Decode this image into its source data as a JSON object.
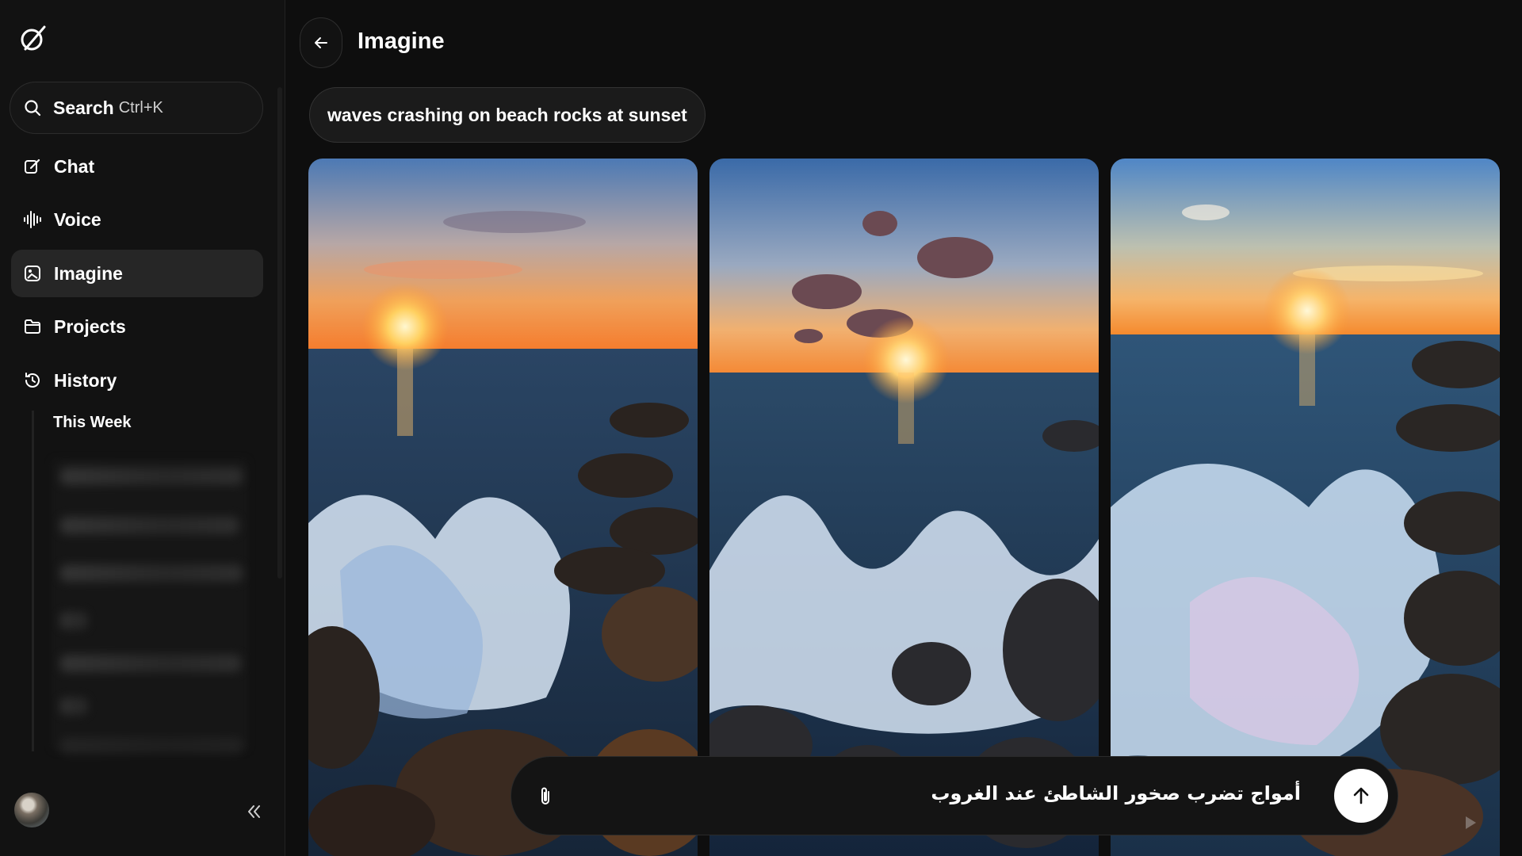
{
  "sidebar": {
    "logo_icon": "grok-logo-icon",
    "search": {
      "label": "Search",
      "shortcut": "Ctrl+K",
      "icon": "search-icon"
    },
    "items": [
      {
        "label": "Chat",
        "icon": "edit-icon"
      },
      {
        "label": "Voice",
        "icon": "voice-waveform-icon"
      },
      {
        "label": "Imagine",
        "icon": "image-sparkle-icon",
        "active": true
      },
      {
        "label": "Projects",
        "icon": "folder-icon"
      },
      {
        "label": "History",
        "icon": "history-icon"
      }
    ],
    "history_group": "This Week",
    "collapse_icon": "double-chevron-left-icon",
    "avatar_icon": "user-avatar"
  },
  "header": {
    "back_icon": "arrow-left-icon",
    "title": "Imagine"
  },
  "prompt": {
    "text": "waves crashing on beach rocks at sunset"
  },
  "composer": {
    "attach_icon": "paperclip-icon",
    "value": "أمواج تضرب صخور الشاطئ عند الغروب",
    "send_icon": "arrow-up-icon"
  },
  "colors": {
    "background": "#0e0e0e",
    "sidebar": "#121212",
    "active_item": "#262626",
    "text": "#ffffff",
    "send_button": "#ffffff"
  }
}
